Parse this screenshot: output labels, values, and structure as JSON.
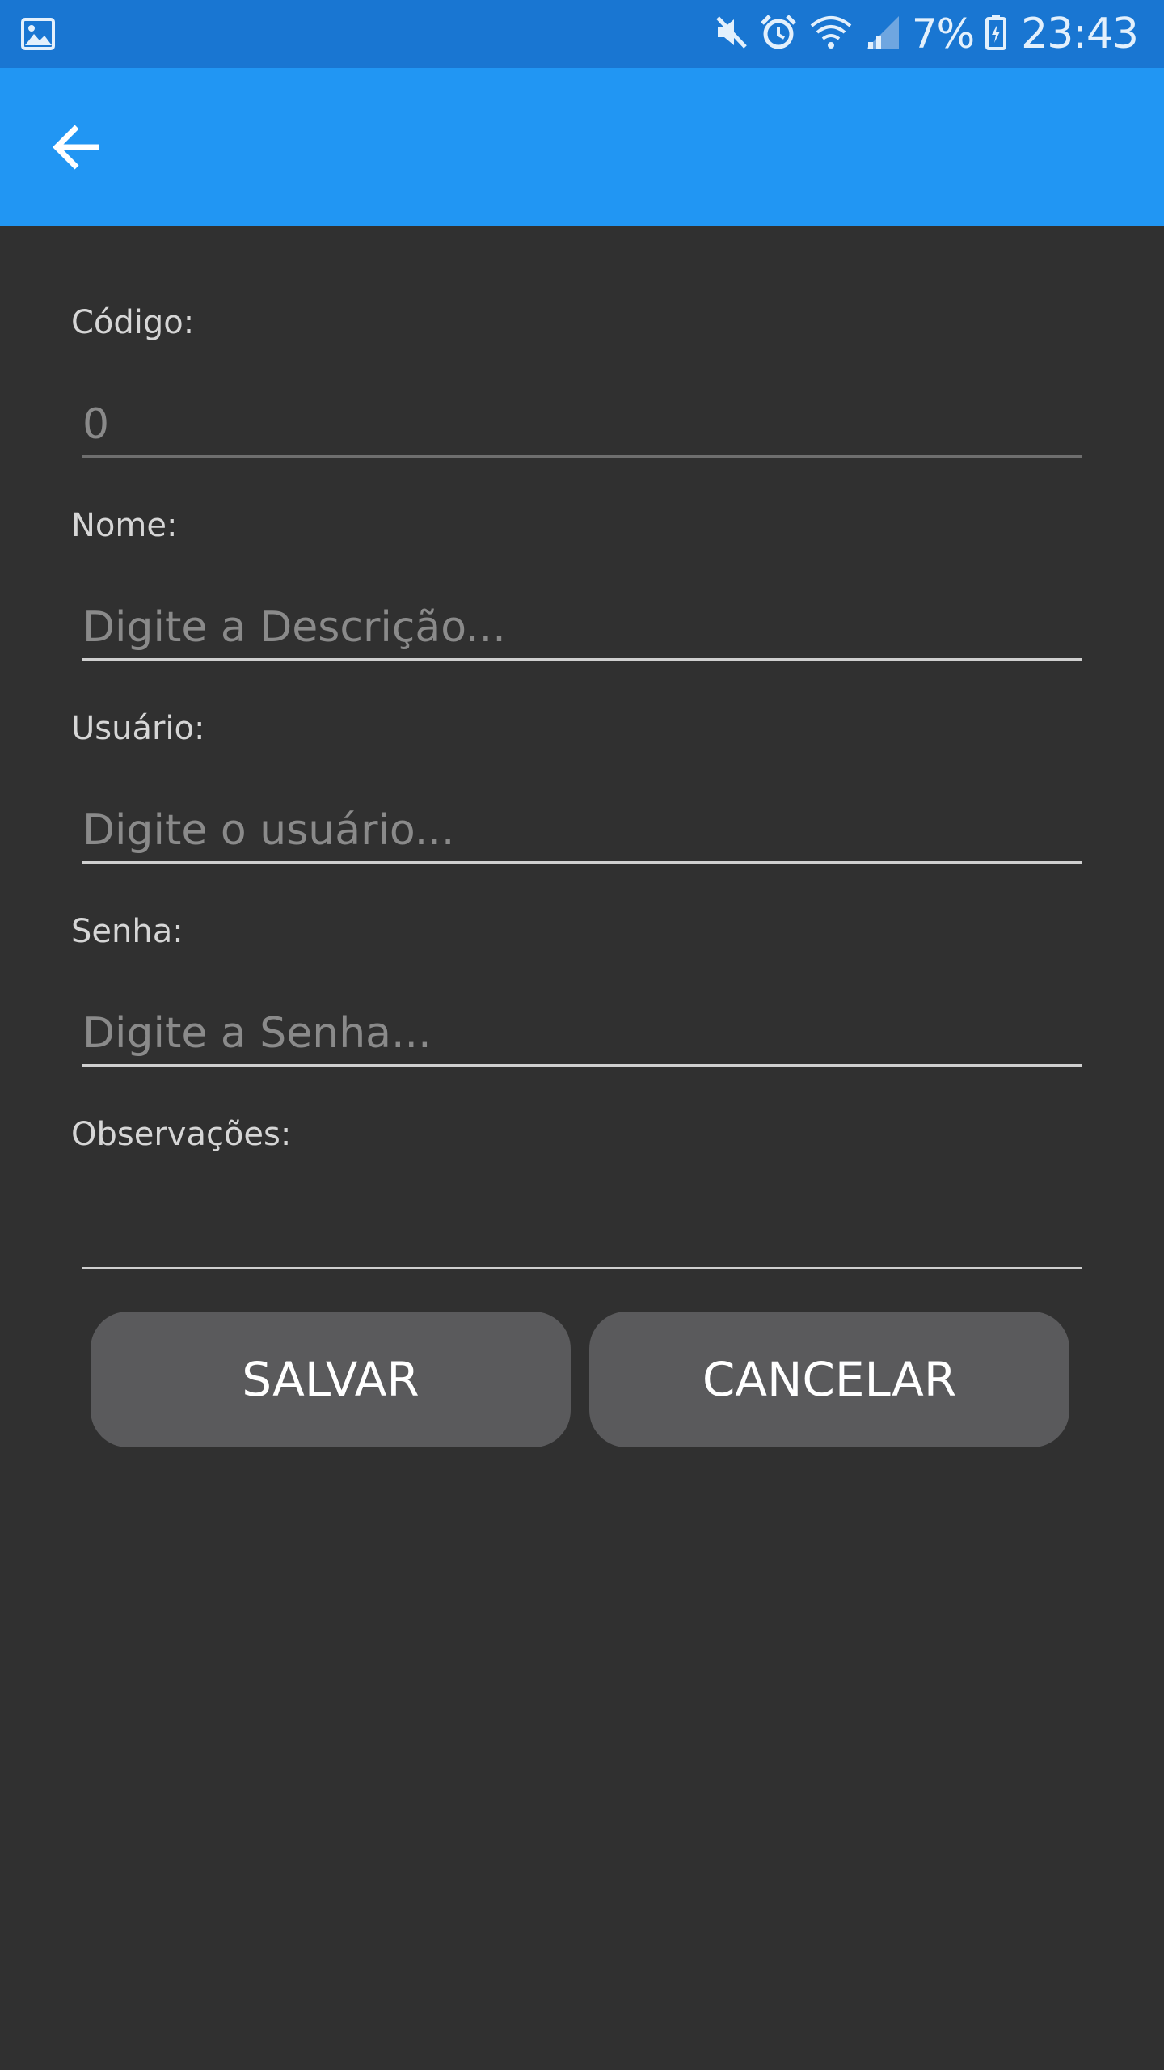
{
  "status_bar": {
    "battery_percent": "7%",
    "time": "23:43",
    "icons": [
      "gallery-icon",
      "mute-icon",
      "alarm-icon",
      "wifi-icon",
      "signal-icon",
      "battery-icon"
    ]
  },
  "app_bar": {
    "back_icon": "arrow-left-icon",
    "color": "#2196f3"
  },
  "form": {
    "codigo": {
      "label": "Código:",
      "value": "0",
      "placeholder": ""
    },
    "nome": {
      "label": "Nome:",
      "value": "",
      "placeholder": "Digite a Descrição..."
    },
    "usuario": {
      "label": "Usuário:",
      "value": "",
      "placeholder": "Digite o usuário..."
    },
    "senha": {
      "label": "Senha:",
      "value": "",
      "placeholder": "Digite a Senha..."
    },
    "observacoes": {
      "label": "Observações:",
      "value": "",
      "placeholder": ""
    }
  },
  "actions": {
    "save_label": "SALVAR",
    "cancel_label": "CANCELAR"
  },
  "colors": {
    "background": "#303030",
    "status_bar": "#1976d2",
    "button": "#5a5a5c"
  }
}
